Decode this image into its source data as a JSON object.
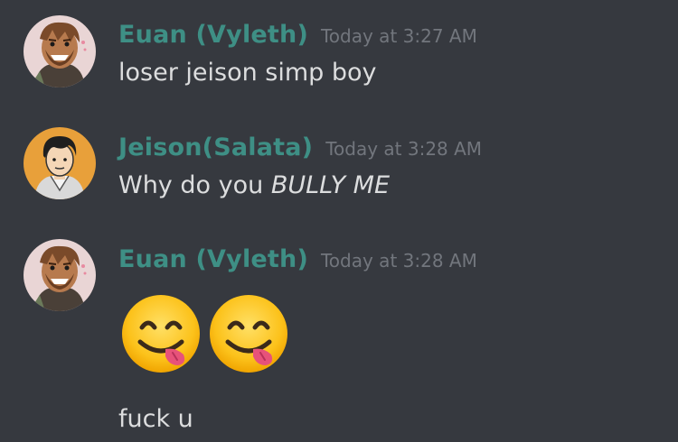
{
  "messages": [
    {
      "author": "Euan (Vyleth)",
      "timestamp": "Today at 3:27 AM",
      "text": "loser jeison simp boy",
      "avatar_icon": "avatar-euan"
    },
    {
      "author": "Jeison(Salata)",
      "timestamp": "Today at 3:28 AM",
      "text_plain": "Why do you ",
      "text_italic": "BULLY ME",
      "avatar_icon": "avatar-jeison"
    },
    {
      "author": "Euan (Vyleth)",
      "timestamp": "Today at 3:28 AM",
      "emojis": [
        "face-savoring-food-emoji",
        "face-savoring-food-emoji"
      ],
      "text": "fuck u",
      "avatar_icon": "avatar-euan"
    }
  ],
  "colors": {
    "background": "#36393f",
    "username": "#3e8f85",
    "timestamp": "#72767d",
    "text": "#dcddde"
  }
}
